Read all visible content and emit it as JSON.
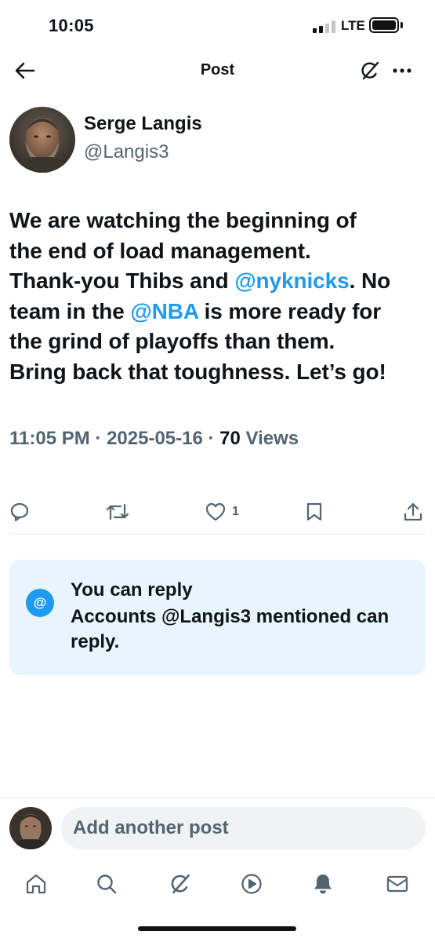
{
  "status_bar": {
    "time": "10:05",
    "network": "LTE"
  },
  "header": {
    "title": "Post",
    "icons": {
      "back": "arrow-left-icon",
      "grok": "grok-slash-icon",
      "more": "more-horizontal-icon"
    }
  },
  "post": {
    "author": {
      "name": "Serge Langis",
      "handle": "@Langis3"
    },
    "text_lines": [
      [
        {
          "text": "We are watching the beginning of"
        }
      ],
      [
        {
          "text": "the end of load management."
        }
      ],
      [
        {
          "text": "Thank-you Thibs and "
        },
        {
          "text": "@nyknicks",
          "mention": true
        },
        {
          "text": ". No"
        }
      ],
      [
        {
          "text": "team in the "
        },
        {
          "text": "@NBA",
          "mention": true
        },
        {
          "text": " is more ready for"
        }
      ],
      [
        {
          "text": "the grind of playoffs than them."
        }
      ],
      [
        {
          "text": "Bring back that toughness. Let’s go!"
        }
      ]
    ],
    "meta": {
      "time": "11:05 PM",
      "separator": " · ",
      "date": "2025-05-16",
      "views_count": "70",
      "views_label": " Views"
    },
    "actions": {
      "reply_icon": "reply-bubble-icon",
      "repost_icon": "repost-icon",
      "like_icon": "heart-icon",
      "like_count": "1",
      "bookmark_icon": "bookmark-icon",
      "share_icon": "share-icon"
    }
  },
  "reply_restriction": {
    "icon_glyph": "@",
    "title": "You can reply",
    "description": "Accounts @Langis3 mentioned can reply."
  },
  "composer": {
    "placeholder": "Add another post"
  },
  "bottom_nav": [
    "home-icon",
    "search-icon",
    "grok-icon",
    "video-play-icon",
    "notifications-bell-icon",
    "messages-envelope-icon"
  ],
  "colors": {
    "accent": "#1d9bf0",
    "secondary_text": "#536471",
    "reply_card_bg": "#e8f5fd"
  }
}
